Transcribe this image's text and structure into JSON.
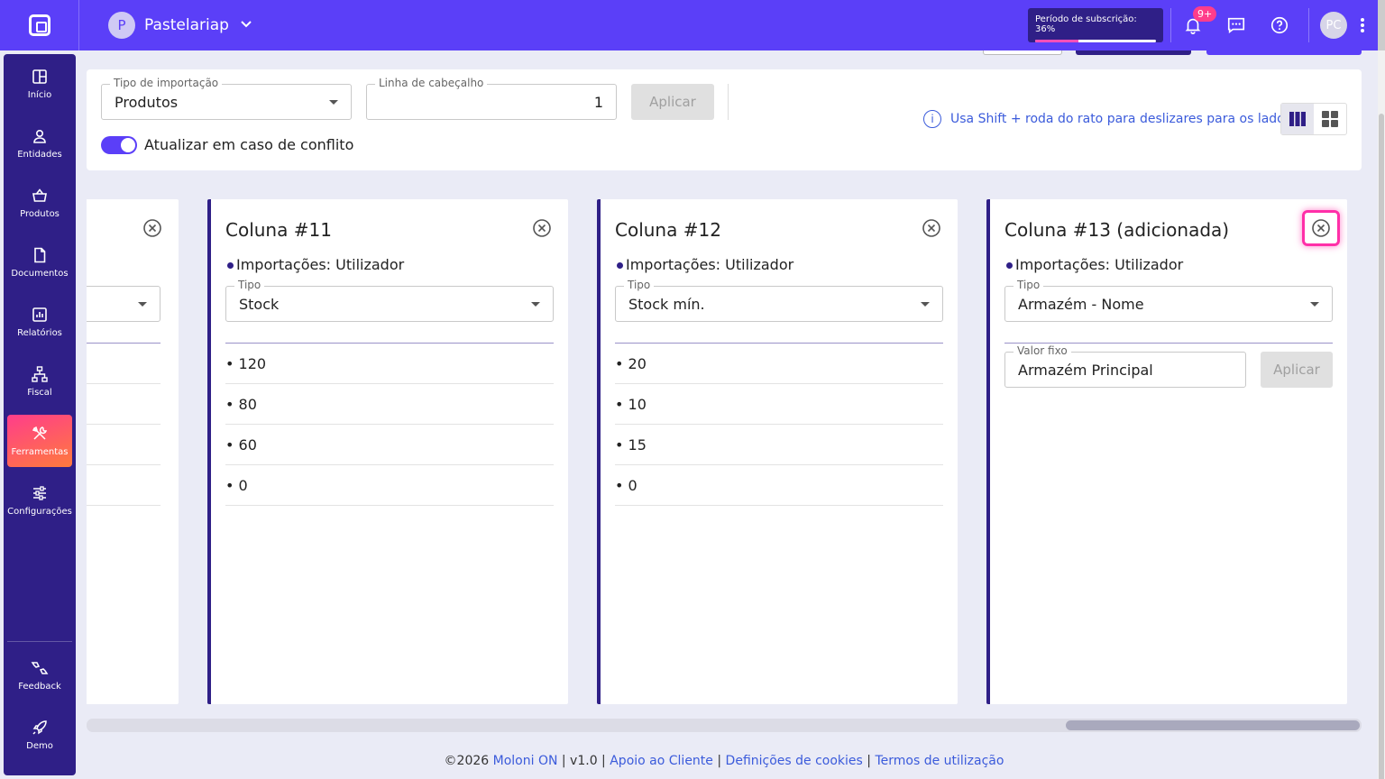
{
  "topbar": {
    "company_initial": "P",
    "company_name": "Pastelariap",
    "subscription_label": "Período de subscrição: 36%",
    "subscription_progress": 36,
    "notifications_badge": "9+",
    "user_initials": "PC"
  },
  "sidebar": {
    "items": [
      {
        "label": "Início",
        "icon": "grid-icon"
      },
      {
        "label": "Entidades",
        "icon": "person-icon"
      },
      {
        "label": "Produtos",
        "icon": "basket-icon"
      },
      {
        "label": "Documentos",
        "icon": "document-icon"
      },
      {
        "label": "Relatórios",
        "icon": "chart-icon"
      },
      {
        "label": "Fiscal",
        "icon": "hierarchy-icon"
      },
      {
        "label": "Ferramentas",
        "icon": "tools-icon",
        "active": true
      },
      {
        "label": "Configurações",
        "icon": "sliders-icon"
      }
    ],
    "bottom_items": [
      {
        "label": "Feedback",
        "icon": "feedback-icon"
      },
      {
        "label": "Demo",
        "icon": "rocket-icon"
      }
    ]
  },
  "config": {
    "import_type_label": "Tipo de importação",
    "import_type_value": "Produtos",
    "header_line_label": "Linha de cabeçalho",
    "header_line_value": "1",
    "apply_label": "Aplicar",
    "conflict_toggle_label": "Atualizar em caso de conflito",
    "conflict_toggle_on": true,
    "hint_text": "Usa Shift + roda do rato para deslizares para os lados"
  },
  "columns": [
    {
      "title": "",
      "imports": "",
      "type_label": "",
      "type_value": "",
      "rows": [
        "",
        "",
        "",
        ""
      ]
    },
    {
      "title": "Coluna #11",
      "imports": "Importações: Utilizador",
      "type_label": "Tipo",
      "type_value": "Stock",
      "rows": [
        "• 120",
        "• 80",
        "• 60",
        "• 0"
      ]
    },
    {
      "title": "Coluna #12",
      "imports": "Importações: Utilizador",
      "type_label": "Tipo",
      "type_value": "Stock mín.",
      "rows": [
        "• 20",
        "• 10",
        "• 15",
        "• 0"
      ]
    },
    {
      "title": "Coluna #13 (adicionada)",
      "imports": "Importações: Utilizador",
      "type_label": "Tipo",
      "type_value": "Armazém - Nome",
      "fixed_value_label": "Valor fixo",
      "fixed_value": "Armazém Principal",
      "apply_label": "Aplicar"
    }
  ],
  "footer": {
    "copyright": "©2026 ",
    "brand": "Moloni ON",
    "version": " | v1.0 | ",
    "support": "Apoio ao Cliente",
    "sep1": " | ",
    "cookies": "Definições de cookies",
    "sep2": " | ",
    "terms": "Termos de utilização"
  },
  "colors": {
    "brand": "#5b3ff8",
    "sidebar": "#2f1f87",
    "accent_pink": "#ff3d8b",
    "link": "#3b5bdb"
  }
}
